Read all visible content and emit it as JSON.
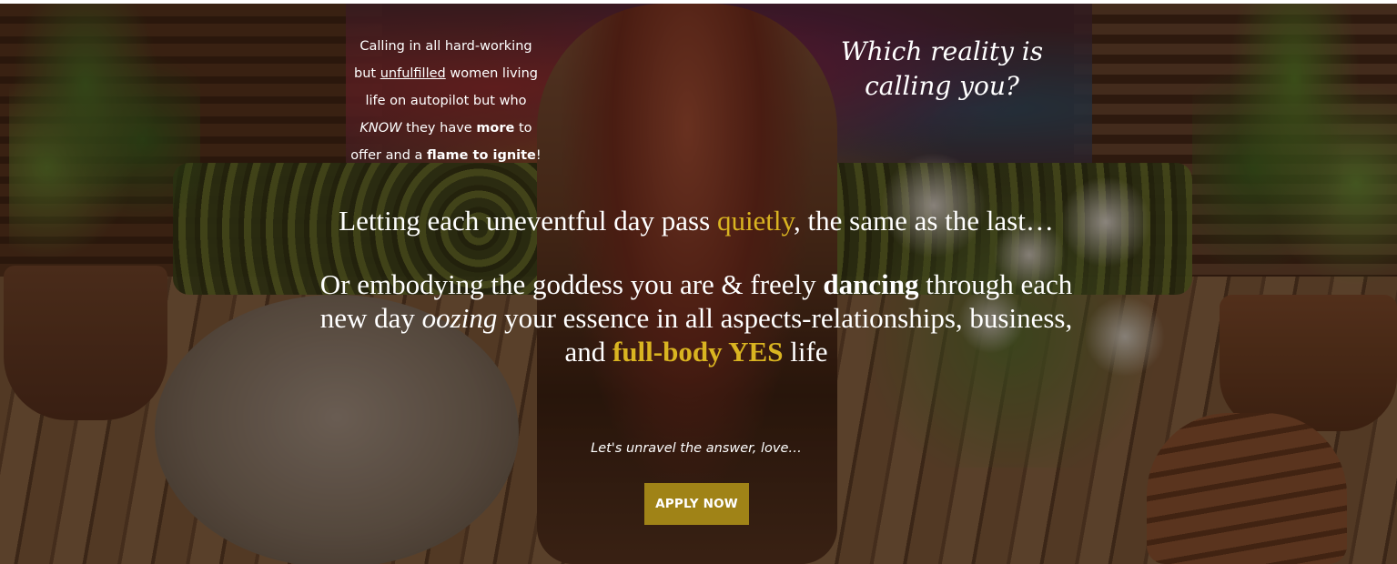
{
  "hero": {
    "intro": {
      "l1": "Calling in all hard-working",
      "l2_pre": "but ",
      "l2_underline": "unfulfilled",
      "l2_post": " women living",
      "l3": "life on autopilot but who",
      "l4_italic": "KNOW",
      "l4_mid": " they have ",
      "l4_bold": "more",
      "l4_post": " to",
      "l5_pre": "offer and a ",
      "l5_bold": "flame to ignite",
      "l5_post": "!"
    },
    "question": {
      "line1": "Which reality is",
      "line2": "calling you?"
    },
    "para1": {
      "pre": "Letting each uneventful day pass ",
      "highlight": "quietly",
      "post": ", the same as the last…"
    },
    "para2": {
      "t1": "Or embodying the goddess you are & freely ",
      "b1": "dancing",
      "t2": " through each new day ",
      "i1": "oozing",
      "t3": " your essence in all aspects-relationships, business, and ",
      "highlight": "full-body YES",
      "t4": " life"
    },
    "tagline": "Let's unravel the answer, love…",
    "cta": "APPLY NOW"
  },
  "colors": {
    "accent_gold": "#d9b421",
    "button_gold": "#a08317",
    "text": "#ffffff"
  }
}
